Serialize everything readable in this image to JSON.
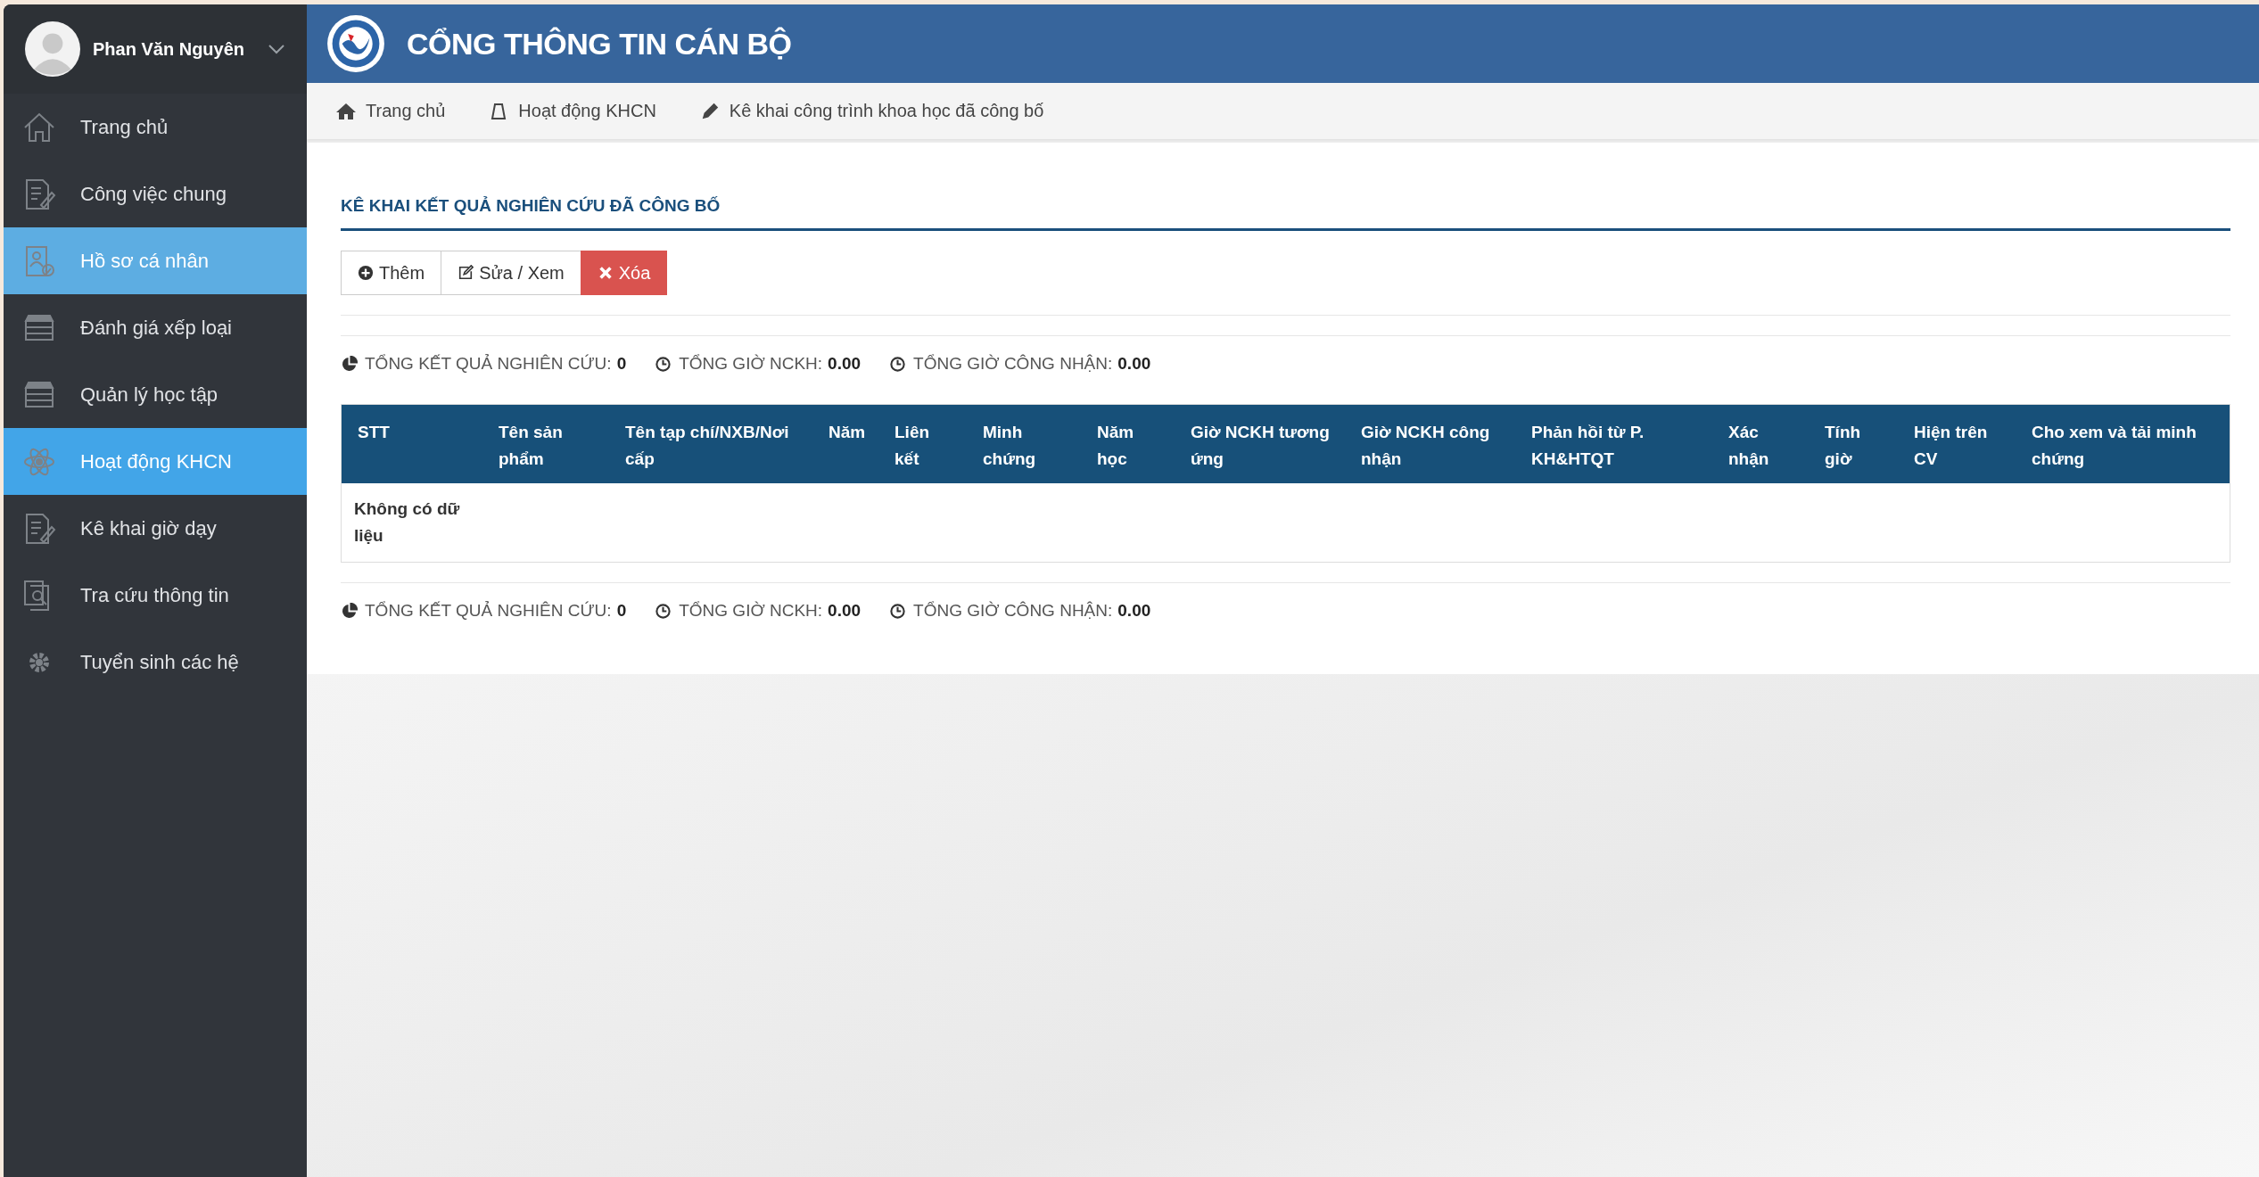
{
  "user": {
    "name": "Phan Văn Nguyên"
  },
  "sidebar": {
    "items": [
      {
        "label": "Trang chủ",
        "kind": "home",
        "selected": false,
        "hovered": false
      },
      {
        "label": "Công việc chung",
        "kind": "doc",
        "selected": false,
        "hovered": false
      },
      {
        "label": "Hồ sơ cá nhân",
        "kind": "profile",
        "selected": false,
        "hovered": true
      },
      {
        "label": "Đánh giá xếp loại",
        "kind": "books",
        "selected": false,
        "hovered": false
      },
      {
        "label": "Quản lý học tập",
        "kind": "books",
        "selected": false,
        "hovered": false
      },
      {
        "label": "Hoạt động KHCN",
        "kind": "atom",
        "selected": true,
        "hovered": false
      },
      {
        "label": "Kê khai giờ dạy",
        "kind": "doc",
        "selected": false,
        "hovered": false
      },
      {
        "label": "Tra cứu thông tin",
        "kind": "search",
        "selected": false,
        "hovered": false
      },
      {
        "label": "Tuyển sinh các hệ",
        "kind": "gear",
        "selected": false,
        "hovered": false
      }
    ]
  },
  "header": {
    "title": "CỔNG THÔNG TIN CÁN BỘ"
  },
  "breadcrumb": [
    {
      "label": "Trang chủ",
      "kind": "home"
    },
    {
      "label": "Hoạt động KHCN",
      "kind": "flask"
    },
    {
      "label": "Kê khai công trình khoa học đã công bố",
      "kind": "pencil"
    }
  ],
  "panel": {
    "title": "KÊ KHAI KẾT QUẢ NGHIÊN CỨU ĐÃ CÔNG BỐ"
  },
  "buttons": [
    {
      "label": "Thêm",
      "kind": "add"
    },
    {
      "label": "Sửa / Xem",
      "kind": "edit"
    },
    {
      "label": "Xóa",
      "kind": "delete"
    }
  ],
  "totals_top": [
    {
      "label": "TỔNG KẾT QUẢ NGHIÊN CỨU:",
      "value": "0",
      "kind": "pie"
    },
    {
      "label": "TỔNG GIỜ NCKH:",
      "value": "0.00",
      "kind": "clock"
    },
    {
      "label": "TỔNG GIỜ CÔNG NHẬN:",
      "value": "0.00",
      "kind": "clock"
    }
  ],
  "table": {
    "columns": [
      "STT",
      "Tên sản phẩm",
      "Tên tạp chí/NXB/Nơi cấp",
      "Năm",
      "Liên kết",
      "Minh chứng",
      "Năm học",
      "Giờ NCKH tương ứng",
      "Giờ NCKH công nhận",
      "Phản hồi từ P. KH&HTQT",
      "Xác nhận",
      "Tính giờ",
      "Hiện trên CV",
      "Cho xem và tải minh chứng"
    ],
    "empty_message": "Không có dữ liệu"
  },
  "totals_bottom": [
    {
      "label": "TỔNG KẾT QUẢ NGHIÊN CỨU:",
      "value": "0",
      "kind": "pie"
    },
    {
      "label": "TỔNG GIỜ NCKH:",
      "value": "0.00",
      "kind": "clock"
    },
    {
      "label": "TỔNG GIỜ CÔNG NHẬN:",
      "value": "0.00",
      "kind": "clock"
    }
  ]
}
